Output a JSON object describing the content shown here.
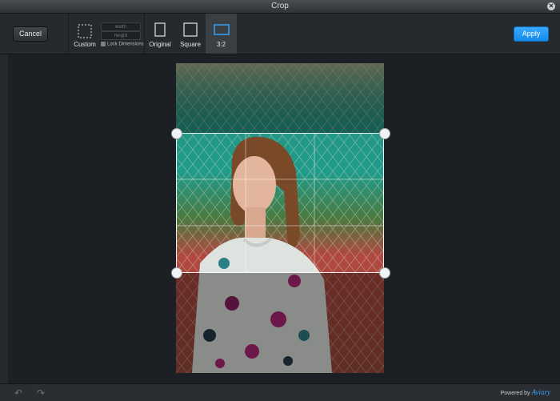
{
  "window": {
    "title": "Crop"
  },
  "toolbar": {
    "cancel_label": "Cancel",
    "apply_label": "Apply",
    "custom_label": "Custom",
    "width_placeholder": "width",
    "height_placeholder": "height",
    "lock_label": "Lock Dimensions",
    "original_label": "Original",
    "square_label": "Square",
    "ratio_label": "3:2",
    "selected_tool": "3:2"
  },
  "footer": {
    "powered_label": "Powered by",
    "brand": "Aviary"
  },
  "colors": {
    "accent": "#1a8cec",
    "selected_tool_bg": "#3a3f44"
  }
}
